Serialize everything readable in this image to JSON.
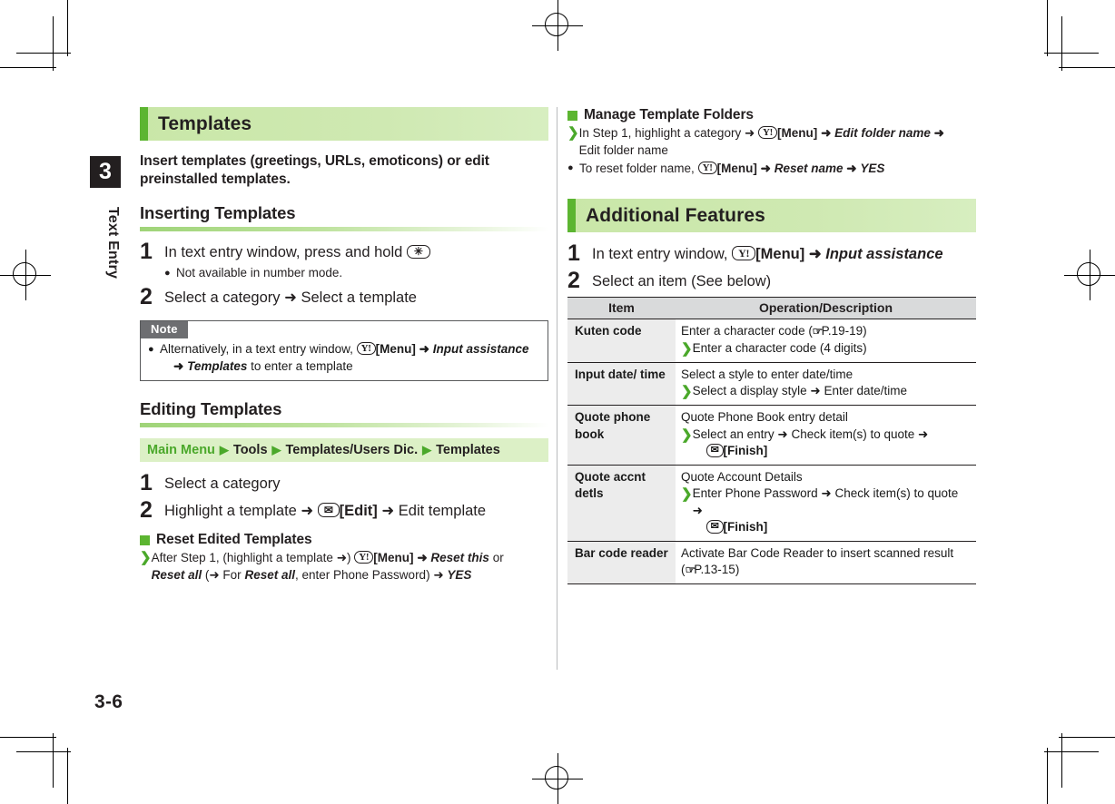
{
  "page": {
    "folio": "3-6",
    "chapter_number": "3",
    "chapter_label": "Text Entry"
  },
  "left_column": {
    "section_title": "Templates",
    "lead": "Insert templates (greetings, URLs, emoticons) or edit preinstalled templates.",
    "inserting": {
      "heading": "Inserting Templates",
      "step1": {
        "num": "1",
        "text_before": "In text entry window, press and hold",
        "key": "✳",
        "sub_bullet": "●",
        "sub_text": "Not available in number mode."
      },
      "step2": {
        "num": "2",
        "text": "Select a category ➜ Select a template"
      }
    },
    "note": {
      "tag": "Note",
      "bullet": "●",
      "line1_a": "Alternatively, in a text entry window,",
      "key": "Y!",
      "line1_b": "[Menu]",
      "arrow1": "➜",
      "line1_c": "Input assistance",
      "line2_arrow": "➜",
      "line2_a": "Templates",
      "line2_b": "to enter a template"
    },
    "editing": {
      "heading": "Editing Templates",
      "menu_path": {
        "root": "Main Menu",
        "segments": [
          "Tools",
          "Templates/Users Dic.",
          "Templates"
        ],
        "separator": "▶"
      },
      "step1": {
        "num": "1",
        "text": "Select a category"
      },
      "step2": {
        "num": "2",
        "text_a": "Highlight a template ➜",
        "key": "✉",
        "text_b": "[Edit]",
        "text_c": "➜ Edit template"
      },
      "reset": {
        "heading": "Reset Edited Templates",
        "gt": "❯",
        "line1_a": "After Step 1, (highlight a template ➜)",
        "key": "Y!",
        "line1_b": "[Menu]",
        "line1_c": "➜",
        "line1_d": "Reset this",
        "line1_e": "or",
        "line2_a": "Reset all",
        "line2_b": "(➜ For",
        "line2_c": "Reset all",
        "line2_d": ", enter Phone Password) ➜",
        "line2_e": "YES"
      }
    }
  },
  "right_column": {
    "manage_folders": {
      "heading": "Manage Template Folders",
      "gt": "❯",
      "line1_a": "In Step 1, highlight a category ➜",
      "key": "Y!",
      "line1_b": "[Menu]",
      "line1_c": "➜",
      "line1_d": "Edit folder name",
      "line1_e": "➜",
      "line2": "Edit folder name",
      "bullet": "●",
      "line3_a": "To reset folder name,",
      "line3_key": "Y!",
      "line3_b": "[Menu]",
      "line3_c": "➜",
      "line3_d": "Reset name",
      "line3_e": "➜",
      "line3_f": "YES"
    },
    "additional_features": {
      "section_title": "Additional Features",
      "step1": {
        "num": "1",
        "text_a": "In text entry window,",
        "key": "Y!",
        "text_b": "[Menu]",
        "text_c": "➜",
        "text_d": "Input assistance"
      },
      "step2": {
        "num": "2",
        "text": "Select an item (See below)"
      }
    },
    "table": {
      "headers": [
        "Item",
        "Operation/Description"
      ],
      "rows": [
        {
          "item": "Kuten code",
          "desc_line1": "Enter a character code (",
          "ref": "P.19-19",
          "desc_line1_end": ")",
          "gt": "❯",
          "desc_line2": "Enter a character code (4 digits)"
        },
        {
          "item": "Input date/ time",
          "desc_line1": "Select a style to enter date/time",
          "gt": "❯",
          "desc_line2": "Select a display style ➜ Enter date/time"
        },
        {
          "item": "Quote phone book",
          "desc_line1": "Quote Phone Book entry detail",
          "gt": "❯",
          "desc_line2": "Select an entry ➜ Check item(s) to quote ➜",
          "key": "✉",
          "desc_line3": "[Finish]"
        },
        {
          "item": "Quote accnt detls",
          "desc_line1": "Quote Account Details",
          "gt": "❯",
          "desc_line2": "Enter Phone Password ➜ Check item(s) to quote ➜",
          "key": "✉",
          "desc_line3": "[Finish]"
        },
        {
          "item": "Bar code reader",
          "desc_line1": "Activate Bar Code Reader to insert scanned result",
          "desc_line2_a": "(",
          "ref": "P.13-15",
          "desc_line2_b": ")"
        }
      ]
    }
  },
  "colors": {
    "accent_green": "#5cb531",
    "band_green": "#c9e7a8",
    "path_green": "#dcf0c6",
    "note_gray": "#6d6e71",
    "table_header_gray": "#d9dadb",
    "table_item_gray": "#ececec",
    "ink": "#231f20"
  }
}
